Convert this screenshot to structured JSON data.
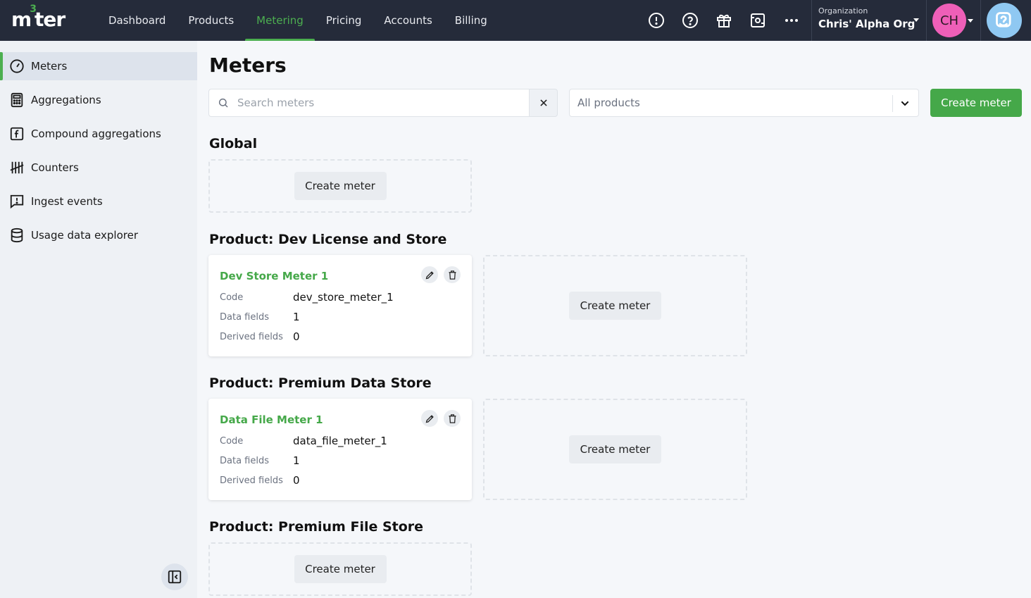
{
  "brand": {
    "logo_left": "m",
    "logo_sup": "3",
    "logo_right": "ter"
  },
  "nav": {
    "items": [
      {
        "label": "Dashboard"
      },
      {
        "label": "Products"
      },
      {
        "label": "Metering",
        "active": true
      },
      {
        "label": "Pricing"
      },
      {
        "label": "Accounts"
      },
      {
        "label": "Billing"
      }
    ]
  },
  "org": {
    "label": "Organization",
    "name": "Chris' Alpha Org"
  },
  "user": {
    "initials": "CH"
  },
  "sidebar": {
    "items": [
      {
        "label": "Meters",
        "icon": "gauge-icon",
        "active": true
      },
      {
        "label": "Aggregations",
        "icon": "calculator-icon"
      },
      {
        "label": "Compound aggregations",
        "icon": "function-icon"
      },
      {
        "label": "Counters",
        "icon": "tally-icon"
      },
      {
        "label": "Ingest events",
        "icon": "message-alert-icon"
      },
      {
        "label": "Usage data explorer",
        "icon": "database-icon"
      }
    ]
  },
  "page": {
    "title": "Meters"
  },
  "search": {
    "placeholder": "Search meters"
  },
  "filter": {
    "selected": "All products"
  },
  "actions": {
    "create_meter": "Create meter"
  },
  "sections": [
    {
      "title": "Global",
      "meters": []
    },
    {
      "title": "Product: Dev License and Store",
      "meters": [
        {
          "name": "Dev Store Meter 1",
          "code_label": "Code",
          "code": "dev_store_meter_1",
          "data_fields_label": "Data fields",
          "data_fields": "1",
          "derived_fields_label": "Derived fields",
          "derived_fields": "0"
        }
      ]
    },
    {
      "title": "Product: Premium Data Store",
      "meters": [
        {
          "name": "Data File Meter 1",
          "code_label": "Code",
          "code": "data_file_meter_1",
          "data_fields_label": "Data fields",
          "data_fields": "1",
          "derived_fields_label": "Derived fields",
          "derived_fields": "0"
        }
      ]
    },
    {
      "title": "Product: Premium File Store",
      "meters": []
    }
  ],
  "colors": {
    "accent": "#45a849",
    "topbar": "#252b3a",
    "avatar": "#ee5fb8",
    "help_avatar": "#8fc8f2"
  }
}
